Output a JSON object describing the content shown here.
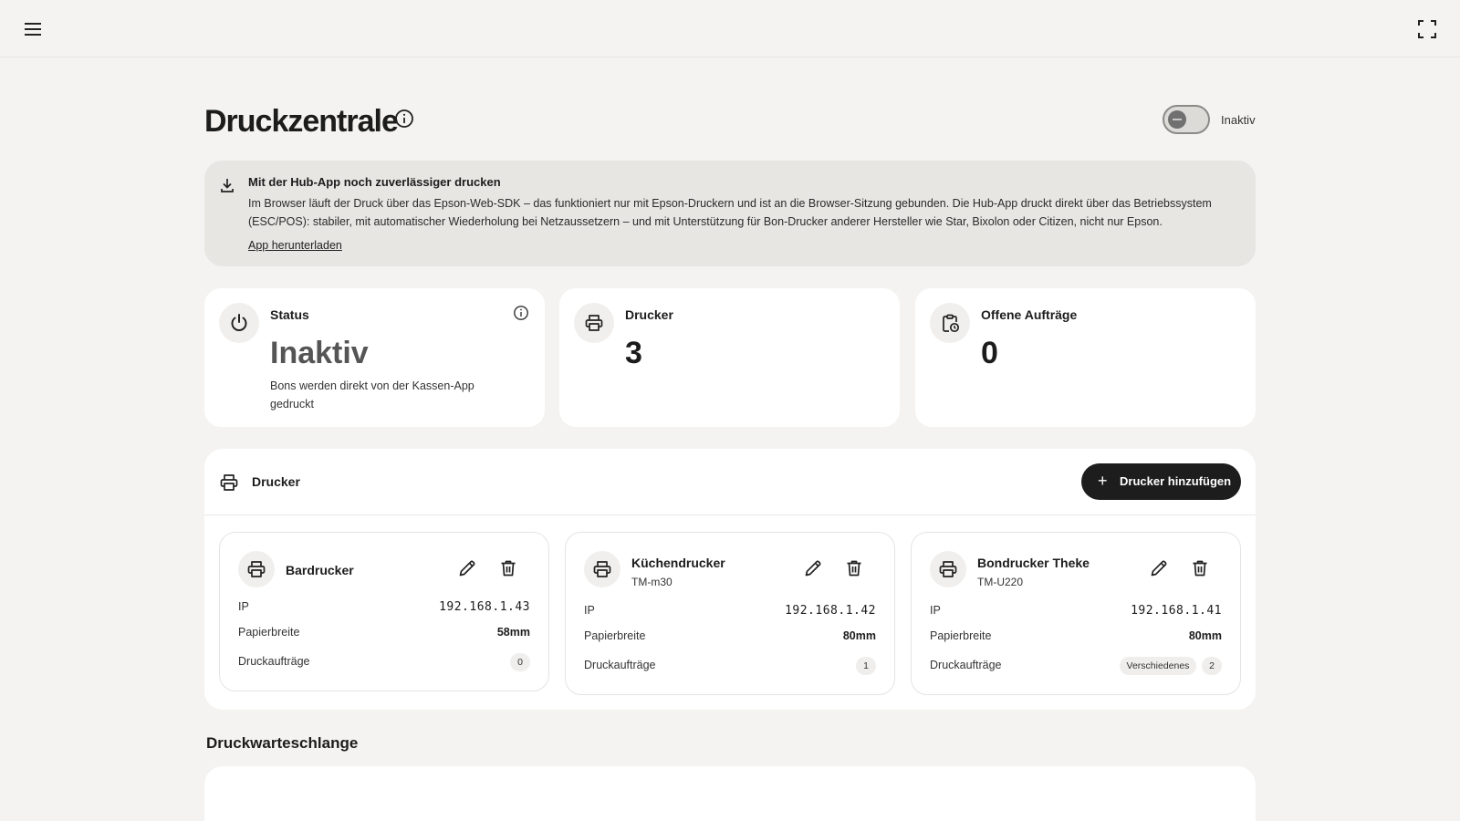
{
  "header": {
    "menu_icon": "hamburger-menu-icon",
    "fullscreen_icon": "fullscreen-icon"
  },
  "page": {
    "title": "Druckzentrale",
    "toggle_label": "Inaktiv",
    "toggle_on": false
  },
  "banner": {
    "title": "Mit der Hub-App noch zuverlässiger drucken",
    "text": "Im Browser läuft der Druck über das Epson-Web-SDK – das funktioniert nur mit Epson-Druckern und ist an die Browser-Sitzung gebunden. Die Hub-App druckt direkt über das Betriebssystem (ESC/POS): stabiler, mit automatischer Wiederholung bei Netzaussetzern – und mit Unterstützung für Bon-Drucker anderer Hersteller wie Star, Bixolon oder Citizen, nicht nur Epson.",
    "link": "App herunterladen"
  },
  "stats": {
    "status": {
      "label": "Status",
      "value": "Inaktiv",
      "description": "Bons werden direkt von der Kassen-App gedruckt"
    },
    "printers": {
      "label": "Drucker",
      "value": "3"
    },
    "open_jobs": {
      "label": "Offene Aufträge",
      "value": "0"
    }
  },
  "printer_section": {
    "title": "Drucker",
    "add_button": "Drucker hinzufügen",
    "labels": {
      "ip": "IP",
      "paper": "Papierbreite",
      "jobs": "Druckaufträge"
    },
    "printers": [
      {
        "name": "Bardrucker",
        "model": "",
        "ip": "192.168.1.43",
        "paper": "58mm",
        "jobs": "0",
        "tag": ""
      },
      {
        "name": "Küchendrucker",
        "model": "TM-m30",
        "ip": "192.168.1.42",
        "paper": "80mm",
        "jobs": "1",
        "tag": ""
      },
      {
        "name": "Bondrucker Theke",
        "model": "TM-U220",
        "ip": "192.168.1.41",
        "paper": "80mm",
        "jobs": "2",
        "tag": "Verschiedenes"
      }
    ]
  },
  "queue": {
    "title": "Druckwarteschlange"
  },
  "colors": {
    "background": "#f4f3f1",
    "card": "#ffffff",
    "banner": "#e8e6e3",
    "primary_button": "#1d1d1d"
  }
}
